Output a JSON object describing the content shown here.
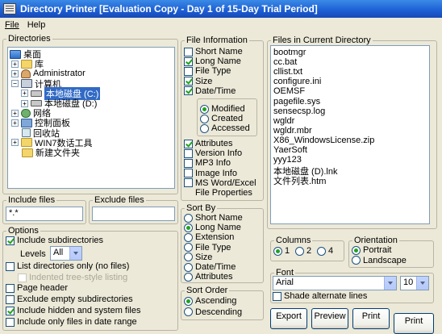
{
  "window": {
    "title": "Directory Printer [Evaluation Copy - Day 1 of 15-Day Trial Period]"
  },
  "menu": [
    "File",
    "Help"
  ],
  "directories": {
    "legend": "Directories",
    "tree": [
      {
        "label": "桌面",
        "icon": "desktop-icon",
        "expander": ""
      },
      {
        "label": "库",
        "icon": "folder-icon",
        "expander": "+"
      },
      {
        "label": "Administrator",
        "icon": "user-icon",
        "expander": "+"
      },
      {
        "label": "计算机",
        "icon": "computer-icon",
        "expander": "−"
      },
      {
        "label": "本地磁盘 (C:)",
        "icon": "drive-icon",
        "expander": "+",
        "selected": true
      },
      {
        "label": "本地磁盘 (D:)",
        "icon": "drive-icon",
        "expander": "+"
      },
      {
        "label": "网络",
        "icon": "network-icon",
        "expander": "+"
      },
      {
        "label": "控制面板",
        "icon": "control-panel-icon",
        "expander": "+"
      },
      {
        "label": "回收站",
        "icon": "recycle-bin-icon",
        "expander": ""
      },
      {
        "label": "WIN7数话工具",
        "icon": "folder-icon",
        "expander": "+"
      },
      {
        "label": "新建文件夹",
        "icon": "folder-icon",
        "expander": ""
      }
    ]
  },
  "include_files": {
    "legend": "Include files",
    "value": "*.*"
  },
  "exclude_files": {
    "legend": "Exclude files",
    "value": ""
  },
  "options": {
    "legend": "Options",
    "include_subdirectories": "Include subdirectories",
    "levels_label": "Levels",
    "levels_value": "All",
    "list_dirs_only": "List directories only (no files)",
    "indented_tree": "Indented tree-style listing",
    "page_header": "Page header",
    "exclude_empty": "Exclude empty subdirectories",
    "include_hidden": "Include hidden and system files",
    "date_range": "Include only files in date range"
  },
  "file_information": {
    "legend": "File Information",
    "items": [
      {
        "label": "Short Name",
        "checked": false
      },
      {
        "label": "Long Name",
        "checked": true
      },
      {
        "label": "File Type",
        "checked": false
      },
      {
        "label": "Size",
        "checked": true
      },
      {
        "label": "Date/Time",
        "checked": true
      }
    ],
    "date_options": [
      {
        "label": "Modified",
        "selected": true
      },
      {
        "label": "Created",
        "selected": false
      },
      {
        "label": "Accessed",
        "selected": false
      }
    ],
    "items2": [
      {
        "label": "Attributes",
        "checked": true
      },
      {
        "label": "Version Info",
        "checked": false
      },
      {
        "label": "MP3 Info",
        "checked": false
      },
      {
        "label": "Image Info",
        "checked": false
      },
      {
        "label": "MS Word/Excel",
        "checked": false
      }
    ],
    "file_properties": "File Properties"
  },
  "sort_by": {
    "legend": "Sort By",
    "items": [
      {
        "label": "Short Name",
        "selected": false
      },
      {
        "label": "Long Name",
        "selected": true
      },
      {
        "label": "Extension",
        "selected": false
      },
      {
        "label": "File Type",
        "selected": false
      },
      {
        "label": "Size",
        "selected": false
      },
      {
        "label": "Date/Time",
        "selected": false
      },
      {
        "label": "Attributes",
        "selected": false
      }
    ]
  },
  "sort_order": {
    "legend": "Sort Order",
    "items": [
      {
        "label": "Ascending",
        "selected": true
      },
      {
        "label": "Descending",
        "selected": false
      }
    ]
  },
  "files": {
    "legend": "Files in Current Directory",
    "items": [
      "bootmgr",
      "cc.bat",
      "cllist.txt",
      "configure.ini",
      "OEMSF",
      "pagefile.sys",
      "sensecsp.log",
      "wgldr",
      "wgldr.mbr",
      "X86_WindowsLicense.zip",
      "YaerSoft",
      "yyy123",
      "本地磁盘 (D).lnk",
      "文件列表.htm"
    ]
  },
  "columns": {
    "legend": "Columns",
    "items": [
      {
        "label": "1",
        "selected": true
      },
      {
        "label": "2",
        "selected": false
      },
      {
        "label": "4",
        "selected": false
      }
    ]
  },
  "orientation": {
    "legend": "Orientation",
    "items": [
      {
        "label": "Portrait",
        "selected": true
      },
      {
        "label": "Landscape",
        "selected": false
      }
    ]
  },
  "font": {
    "legend": "Font",
    "name": "Arial",
    "size": "10",
    "shade_alternate": "Shade alternate lines"
  },
  "buttons": {
    "export": "Export",
    "preview": "Preview",
    "print1": "Print",
    "print2": "Print"
  }
}
